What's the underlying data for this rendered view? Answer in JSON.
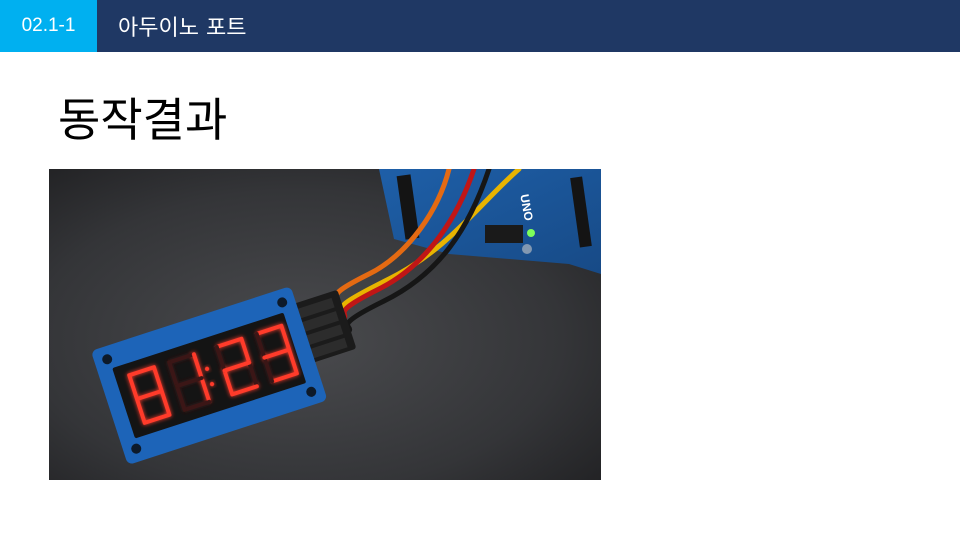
{
  "header": {
    "section_number": "02.1-1",
    "title": "아두이노 포트",
    "bar_color": "#1f3864",
    "badge_color": "#00b0f0"
  },
  "slide": {
    "title": "동작결과"
  },
  "photo": {
    "board_label": "UNO",
    "display_digits": [
      "8",
      "1",
      "2",
      "3"
    ]
  }
}
